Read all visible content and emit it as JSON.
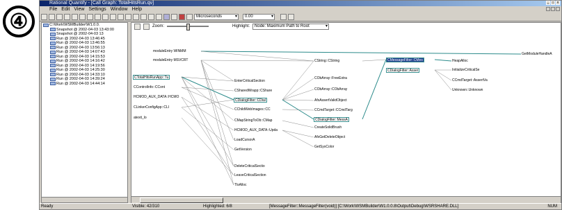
{
  "badge": "④",
  "title": "Rational Quantify - [Call Graph: TotalHitsRun.qv]",
  "menu": [
    "File",
    "Edit",
    "View",
    "Settings",
    "Window",
    "Help"
  ],
  "toolbar": {
    "unit": "Microseconds",
    "precision": "0.00"
  },
  "tree": [
    "C:\\Work\\WSMBuilder\\W1.0.0.",
    "Snapshot @ 2002-04-03 13:43:00",
    "Snapshot @ 2002-04-03 13",
    "Run @ 2002-04-03 13:46:45",
    "Run @ 2002-04-03 13:46:55",
    "Run @ 2002-04-03 13:56:13",
    "Run @ 2002-04-03 14:07:43",
    "Run @ 2002-04-03 14:15:53",
    "Run @ 2002-04-03 14:16:42",
    "Run @ 2002-04-03 14:19:56",
    "Run @ 2002-04-03 14:25:30",
    "Run @ 2002-04-03 14:33:10",
    "Run @ 2002-04-03 14:39:24",
    "Run @ 2002-04-03 14:44:14"
  ],
  "graph_toolbar": {
    "zoom_label": "Zoom:",
    "highlight_label": "Highlight:",
    "highlight_value": "Node: Maximum Path to Root"
  },
  "nodes": [
    {
      "id": "n1",
      "label": "moduleEntry WINMM",
      "style": "plain"
    },
    {
      "id": "n2",
      "label": "moduleEntry MSVCRT",
      "style": "plain"
    },
    {
      "id": "n3",
      "label": "CTotalHitsRunApp::Tu",
      "style": "box"
    },
    {
      "id": "n4",
      "label": "CControlInfo::CCont",
      "style": "plain"
    },
    {
      "id": "n5",
      "label": "HCMOD_AUX_DATA::HCMO",
      "style": "plain"
    },
    {
      "id": "n6",
      "label": "CLinkerConfigApp::CLI",
      "style": "plain"
    },
    {
      "id": "n7",
      "label": "atexit_lo",
      "style": "plain"
    },
    {
      "id": "n8",
      "label": "EnterCriticalSection",
      "style": "plain"
    },
    {
      "id": "n9",
      "label": "CSharedWrapp::CShare",
      "style": "plain"
    },
    {
      "id": "n10",
      "label": "CDialogFilter::CDial",
      "style": "box"
    },
    {
      "id": "n11",
      "label": "CChildWebImages::CC",
      "style": "plain"
    },
    {
      "id": "n12",
      "label": "CMapStringToOb::CMap",
      "style": "plain"
    },
    {
      "id": "n13",
      "label": "HCMOD_AUX_DATA::Upda",
      "style": "plain"
    },
    {
      "id": "n14",
      "label": "LoadCursorA",
      "style": "plain"
    },
    {
      "id": "n15",
      "label": "GetVersion",
      "style": "plain"
    },
    {
      "id": "n16",
      "label": "DeleteCriticalSectio",
      "style": "plain"
    },
    {
      "id": "n17",
      "label": "LeaveCriticalSection",
      "style": "plain"
    },
    {
      "id": "n18",
      "label": "TlsAlloc",
      "style": "plain"
    },
    {
      "id": "n19",
      "label": "CString::CString",
      "style": "plain"
    },
    {
      "id": "n20",
      "label": "CObArray::FreeExtra",
      "style": "plain"
    },
    {
      "id": "n21",
      "label": "CObArray::CObArray",
      "style": "plain"
    },
    {
      "id": "n22",
      "label": "AfxAssertValidObject",
      "style": "plain"
    },
    {
      "id": "n23",
      "label": "CCmdTarget::CCmdTarg",
      "style": "plain"
    },
    {
      "id": "n24",
      "label": "CDialogFilter::MessA",
      "style": "box"
    },
    {
      "id": "n25",
      "label": "CreateSolidBrush",
      "style": "plain"
    },
    {
      "id": "n26",
      "label": "AfxGetDeleteObject",
      "style": "plain"
    },
    {
      "id": "n27",
      "label": "GetSysColor",
      "style": "plain"
    },
    {
      "id": "n28",
      "label": "CMessageFilter::CMes",
      "style": "hl"
    },
    {
      "id": "n29",
      "label": "CDialogFilter::Asser",
      "style": "box"
    },
    {
      "id": "n30",
      "label": "HeapAlloc",
      "style": "plain"
    },
    {
      "id": "n31",
      "label": "InitializeCriticalSe",
      "style": "plain"
    },
    {
      "id": "n32",
      "label": "CCmdTarget::AssertVa",
      "style": "plain"
    },
    {
      "id": "n33",
      "label": "Unknown::Unknown",
      "style": "plain"
    },
    {
      "id": "n34",
      "label": "GetModuleHandleA",
      "style": "plain"
    }
  ],
  "status": {
    "ready": "Ready",
    "visible": "Visible: 42/310",
    "highlighted": "Highlighted: 6/8",
    "function": "[MessageFilter::MessageFilter(void)] [C:\\Work\\WSMBuilder\\W1.0.0.8\\Output\\Debug\\WSRSHARE.DLL]",
    "num": "NUM"
  }
}
